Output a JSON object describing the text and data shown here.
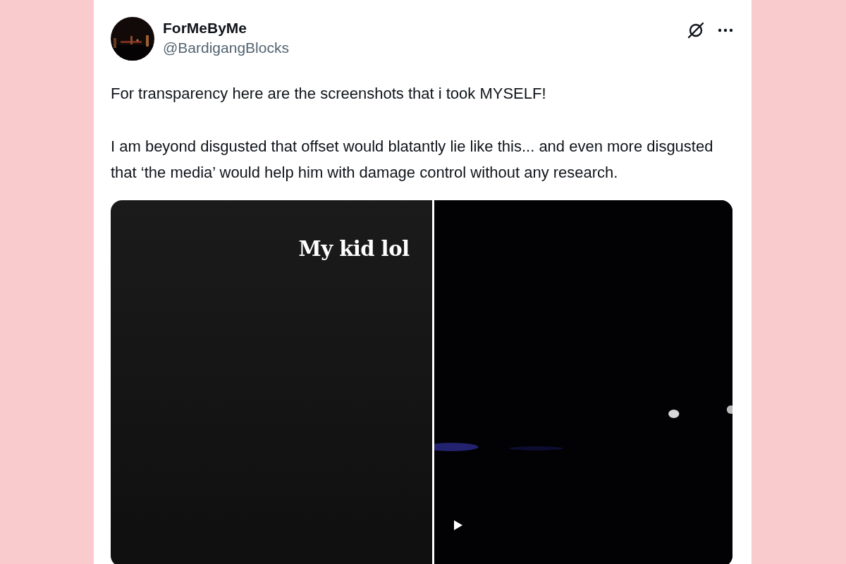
{
  "author": {
    "name": "ForMeByMe",
    "handle": "@BardigangBlocks"
  },
  "paragraphs": [
    "For transparency here are the screenshots that i took MYSELF!",
    "I am beyond disgusted that offset would blatantly lie like this... and even more disgusted that ‘the media’ would help him with damage control without any research."
  ],
  "media": [
    {
      "kind": "screenshot",
      "caption": "My kid lol"
    },
    {
      "kind": "video"
    }
  ]
}
